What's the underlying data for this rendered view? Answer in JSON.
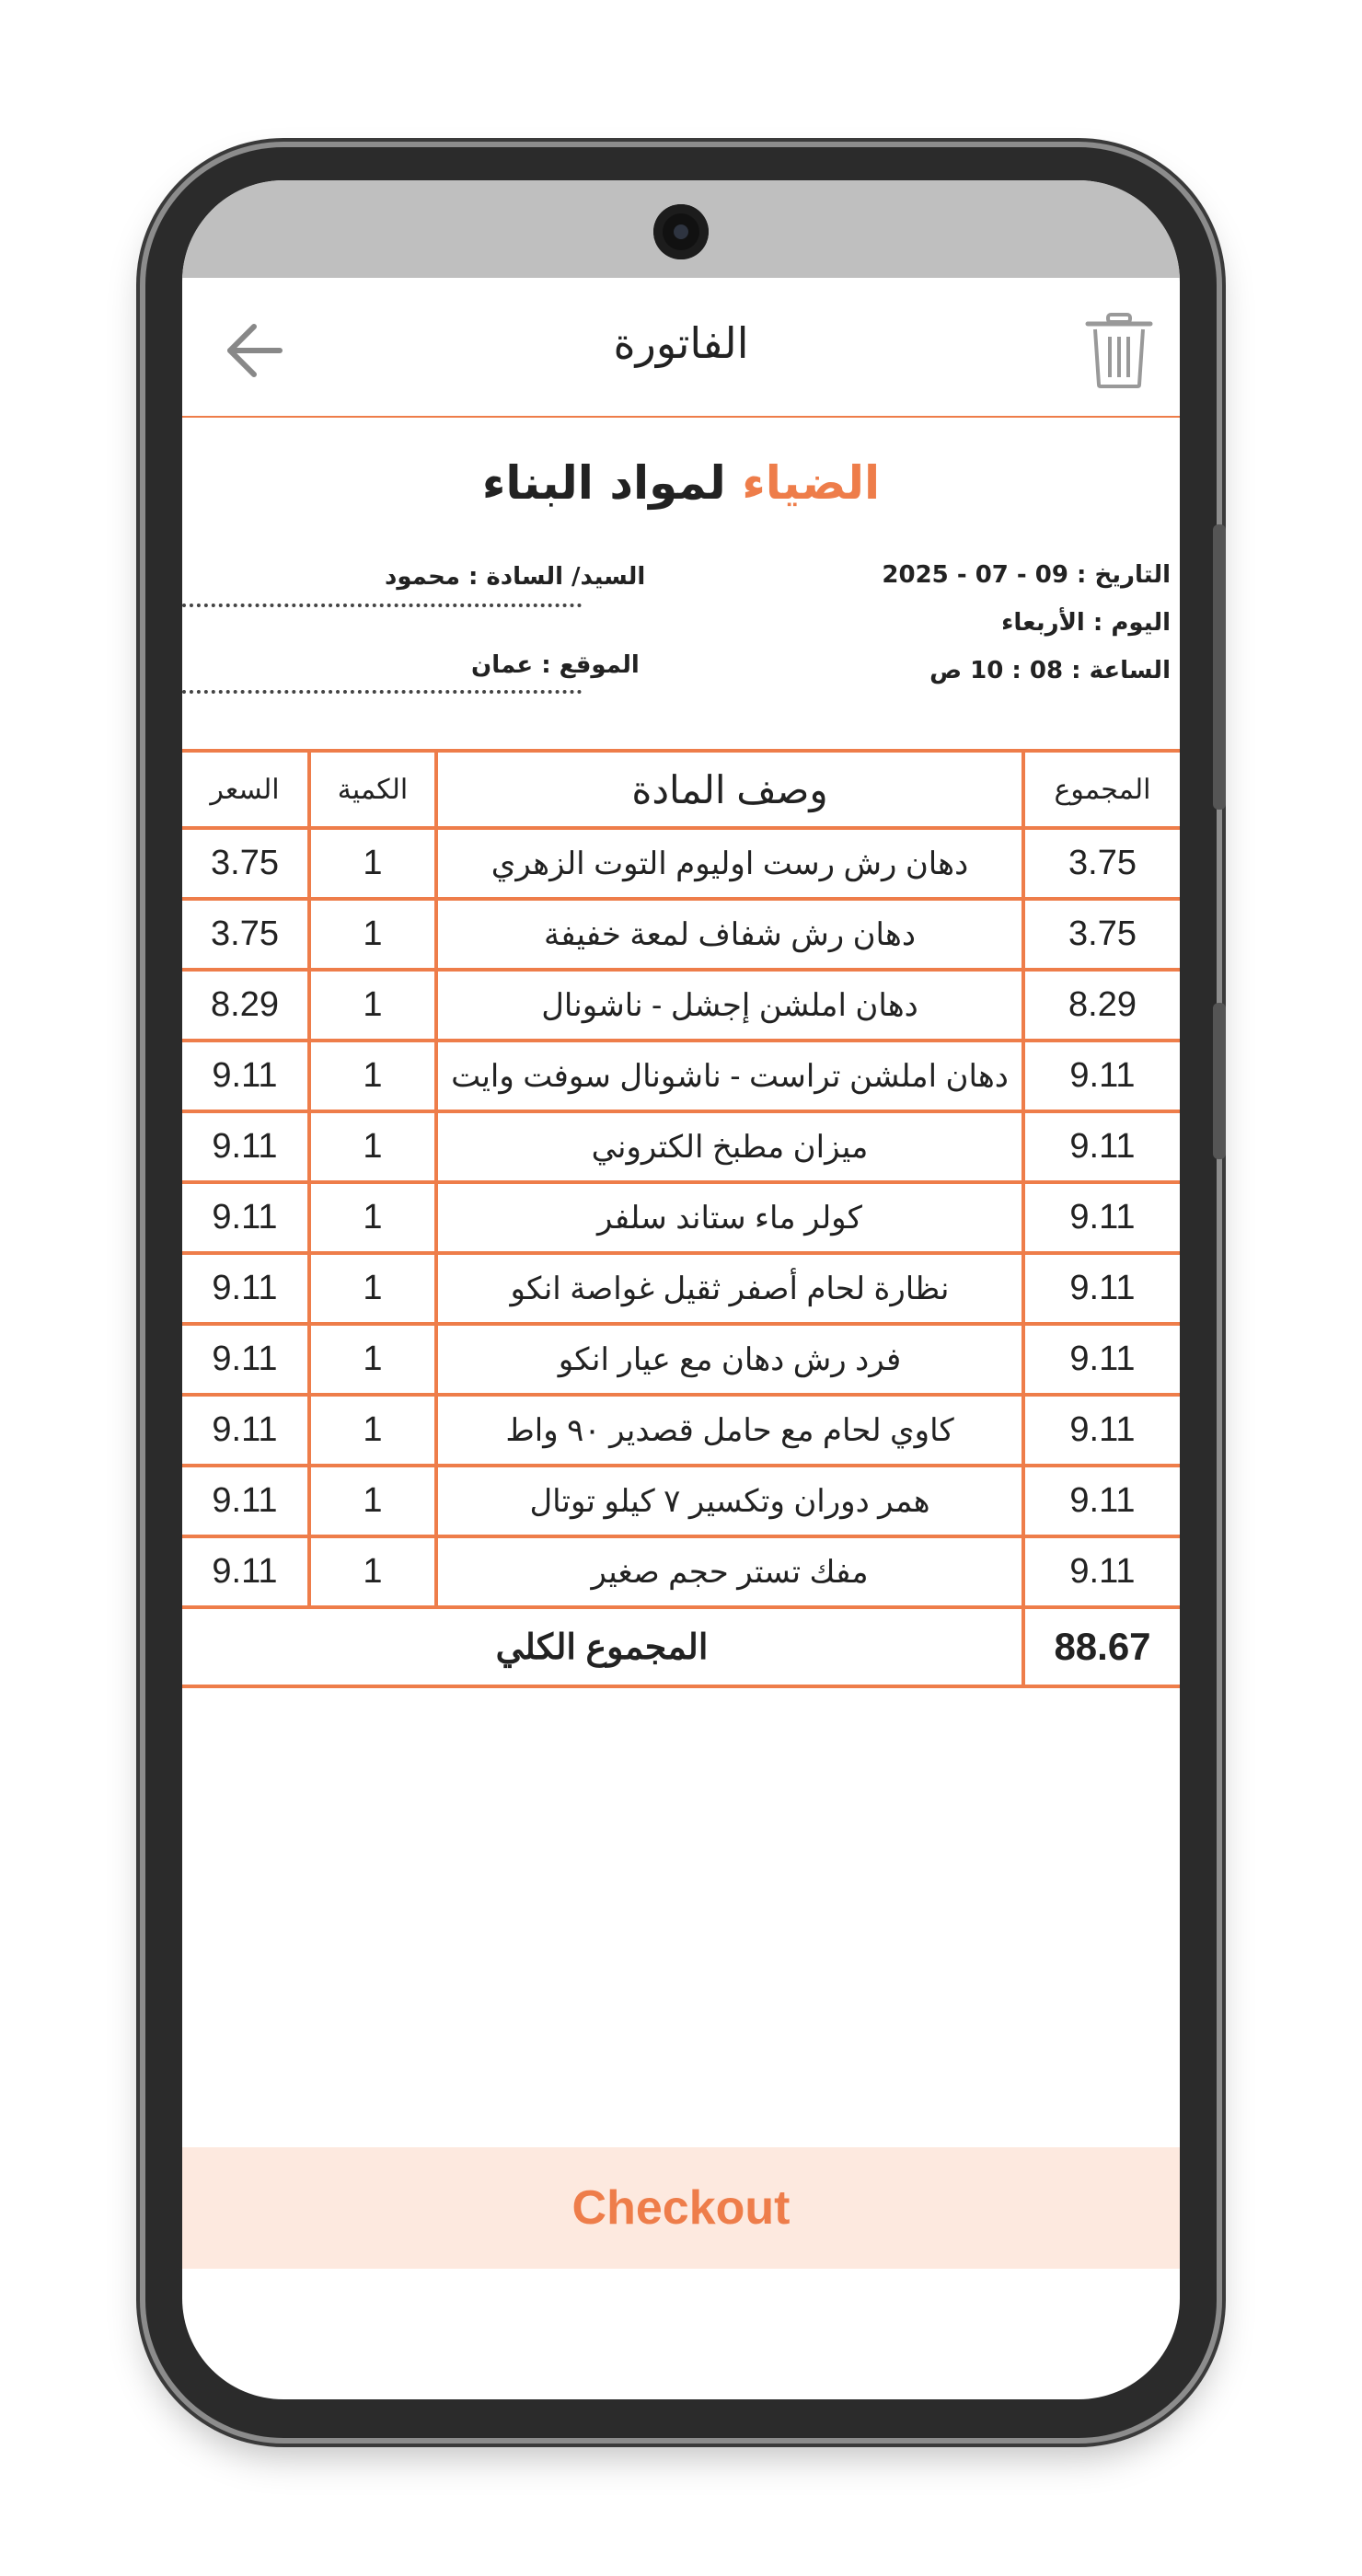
{
  "header": {
    "title": "الفاتورة"
  },
  "company": {
    "name_accent": "الضياء",
    "name_rest": "لمواد البناء"
  },
  "info": {
    "customer": "السيد/ السادة :  محمود",
    "location": "الموقع :  عمان",
    "date": "التاريخ : 09 - 07 - 2025",
    "day": "اليوم : الأربعاء",
    "time": "الساعة : 08 : 10  ص"
  },
  "table": {
    "headers": {
      "total": "المجموع",
      "description": "وصف المادة",
      "quantity": "الكمية",
      "price": "السعر"
    },
    "rows": [
      {
        "total": "3.75",
        "description": "دهان رش رست اوليوم التوت الزهري",
        "quantity": "1",
        "price": "3.75"
      },
      {
        "total": "3.75",
        "description": "دهان رش شفاف لمعة خفيفة",
        "quantity": "1",
        "price": "3.75"
      },
      {
        "total": "8.29",
        "description": "دهان املشن إجشل - ناشونال",
        "quantity": "1",
        "price": "8.29"
      },
      {
        "total": "9.11",
        "description": "دهان املشن تراست - ناشونال سوفت وايت",
        "quantity": "1",
        "price": "9.11"
      },
      {
        "total": "9.11",
        "description": "ميزان مطبخ الكتروني",
        "quantity": "1",
        "price": "9.11"
      },
      {
        "total": "9.11",
        "description": "كولر ماء ستاند سلفر",
        "quantity": "1",
        "price": "9.11"
      },
      {
        "total": "9.11",
        "description": "نظارة لحام أصفر ثقيل غواصة انكو",
        "quantity": "1",
        "price": "9.11"
      },
      {
        "total": "9.11",
        "description": "فرد رش دهان مع عيار انكو",
        "quantity": "1",
        "price": "9.11"
      },
      {
        "total": "9.11",
        "description": "كاوي لحام مع حامل قصدير ٩٠ واط",
        "quantity": "1",
        "price": "9.11"
      },
      {
        "total": "9.11",
        "description": "همر دوران وتكسير ٧ كيلو توتال",
        "quantity": "1",
        "price": "9.11"
      },
      {
        "total": "9.11",
        "description": "مفك تستر حجم صغير",
        "quantity": "1",
        "price": "9.11"
      }
    ],
    "grand_total_label": "المجموع الكلي",
    "grand_total_value": "88.67"
  },
  "checkout": {
    "label": "Checkout"
  },
  "icons": {
    "back": "arrow-left-icon",
    "delete": "trash-icon"
  },
  "colors": {
    "accent": "#ee7d4a",
    "checkout_bg": "#fde9df",
    "statusbar": "#bfbfbf"
  }
}
